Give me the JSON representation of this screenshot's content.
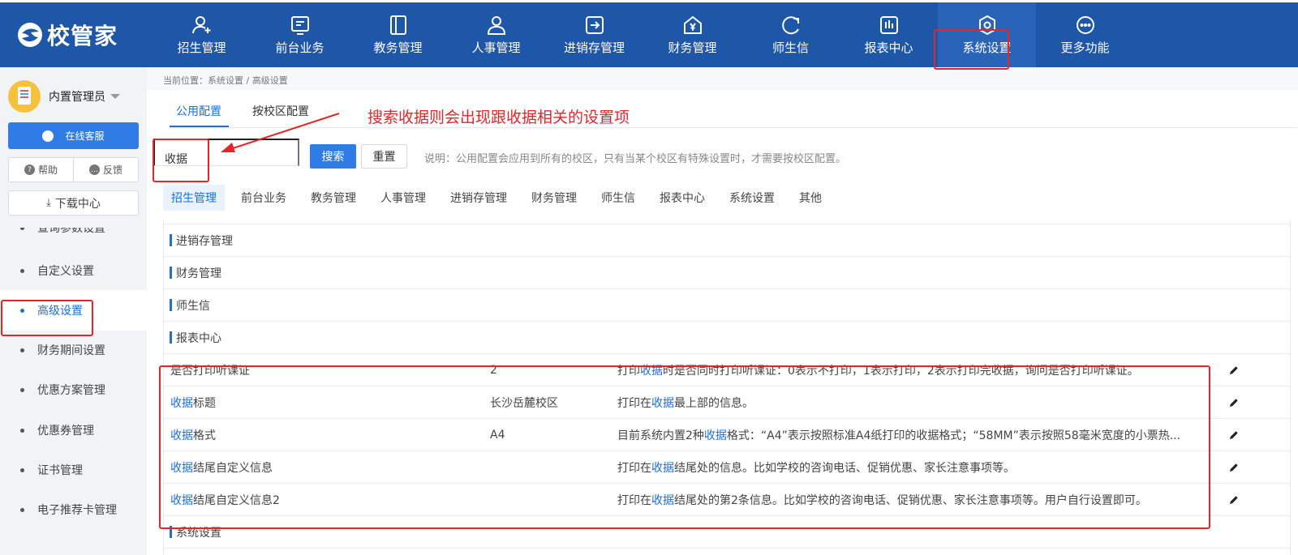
{
  "app": {
    "logo_text": "校管家",
    "brand_color": "#1e56a8",
    "accent_color": "#2f7ce6",
    "annotation_color": "#e5252a"
  },
  "topnav": {
    "items": [
      {
        "label": "招生管理",
        "icon": "user-plus-icon"
      },
      {
        "label": "前台业务",
        "icon": "monitor-icon"
      },
      {
        "label": "教务管理",
        "icon": "book-icon"
      },
      {
        "label": "人事管理",
        "icon": "user-icon"
      },
      {
        "label": "进销存管理",
        "icon": "arrow-box-icon"
      },
      {
        "label": "财务管理",
        "icon": "yen-house-icon"
      },
      {
        "label": "师生信",
        "icon": "chat-bubble-icon"
      },
      {
        "label": "报表中心",
        "icon": "bar-chart-icon"
      },
      {
        "label": "系统设置",
        "icon": "settings-icon",
        "active": true
      },
      {
        "label": "更多功能",
        "icon": "more-icon"
      }
    ]
  },
  "sidebar": {
    "user_name": "内置管理员",
    "service_label": "在线客服",
    "help_label": "帮助",
    "feedback_label": "反馈",
    "download_label": "下载中心",
    "partial_item": "查询参数设置",
    "items": [
      {
        "label": "自定义设置"
      },
      {
        "label": "高级设置",
        "active": true
      },
      {
        "label": "财务期间设置"
      },
      {
        "label": "优惠方案管理"
      },
      {
        "label": "优惠券管理"
      },
      {
        "label": "证书管理"
      },
      {
        "label": "电子推荐卡管理"
      }
    ]
  },
  "main": {
    "breadcrumb": "当前位置：系统设置 / 高级设置",
    "tabs": [
      {
        "label": "公用配置",
        "active": true
      },
      {
        "label": "按校区配置"
      }
    ],
    "annotation": "搜索收据则会出现跟收据相关的设置项",
    "search": {
      "value": "收据",
      "placeholder": ""
    },
    "search_button": "搜索",
    "reset_button": "重置",
    "note": "说明：公用配置会应用到所有的校区，只有当某个校区有特殊设置时，才需要按校区配置。",
    "category_tabs": [
      {
        "label": "招生管理",
        "active": true
      },
      {
        "label": "前台业务"
      },
      {
        "label": "教务管理"
      },
      {
        "label": "人事管理"
      },
      {
        "label": "进销存管理"
      },
      {
        "label": "财务管理"
      },
      {
        "label": "师生信"
      },
      {
        "label": "报表中心"
      },
      {
        "label": "系统设置"
      },
      {
        "label": "其他"
      }
    ],
    "groups": {
      "g1": "进销存管理",
      "g2": "财务管理",
      "g3": "师生信",
      "g4": "报表中心",
      "g5": "系统设置"
    },
    "rows": [
      {
        "name_pre": "是否打印听课证",
        "name_hl": "",
        "name_post": "",
        "value": "2",
        "desc_pre": "打印",
        "desc_hl": "收据",
        "desc_post": "时是否同时打印听课证：0表示不打印，1表示打印，2表示打印完收据，询问是否打印听课证。"
      },
      {
        "name_pre": "",
        "name_hl": "收据",
        "name_post": "标题",
        "value": "长沙岳麓校区",
        "desc_pre": "打印在",
        "desc_hl": "收据",
        "desc_post": "最上部的信息。"
      },
      {
        "name_pre": "",
        "name_hl": "收据",
        "name_post": "格式",
        "value": "A4",
        "desc_pre": "目前系统内置2种",
        "desc_hl": "收据",
        "desc_post": "格式：“A4”表示按照标准A4纸打印的收据格式；“58MM”表示按照58毫米宽度的小票热..."
      },
      {
        "name_pre": "",
        "name_hl": "收据",
        "name_post": "结尾自定义信息",
        "value": "",
        "desc_pre": "打印在",
        "desc_hl": "收据",
        "desc_post": "结尾处的信息。比如学校的咨询电话、促销优惠、家长注意事项等。"
      },
      {
        "name_pre": "",
        "name_hl": "收据",
        "name_post": "结尾自定义信息2",
        "value": "",
        "desc_pre": "打印在",
        "desc_hl": "收据",
        "desc_post": "结尾处的第2条信息。比如学校的咨询电话、促销优惠、家长注意事项等。用户自行设置即可。"
      }
    ]
  }
}
